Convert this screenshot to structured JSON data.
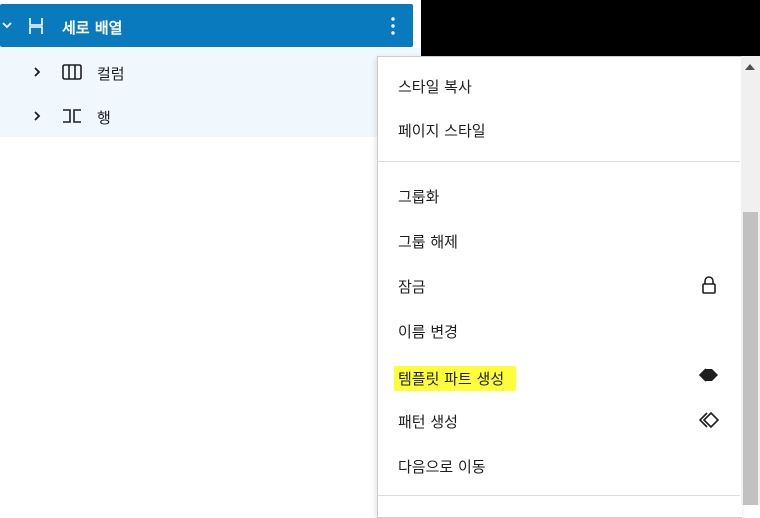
{
  "list_view": {
    "selected": {
      "label": "세로 배열",
      "icon": "stack-vertical-icon"
    },
    "children": [
      {
        "label": "컬럼",
        "icon": "columns-icon"
      },
      {
        "label": "행",
        "icon": "row-icon"
      }
    ]
  },
  "menu": {
    "group1": [
      {
        "label": "스타일 복사"
      },
      {
        "label": "페이지 스타일"
      }
    ],
    "group2": [
      {
        "label": "그룹화"
      },
      {
        "label": "그룹 해제"
      },
      {
        "label": "잠금",
        "icon": "lock-icon"
      },
      {
        "label": "이름 변경"
      },
      {
        "label": "템플릿 파트 생성",
        "icon": "template-part-icon",
        "highlighted": true
      },
      {
        "label": "패턴 생성",
        "icon": "pattern-icon"
      },
      {
        "label": "다음으로 이동"
      }
    ]
  },
  "colors": {
    "selected_bg": "#0a7abf",
    "children_bg": "#f1f8fd",
    "highlight": "#fdfd3a"
  }
}
